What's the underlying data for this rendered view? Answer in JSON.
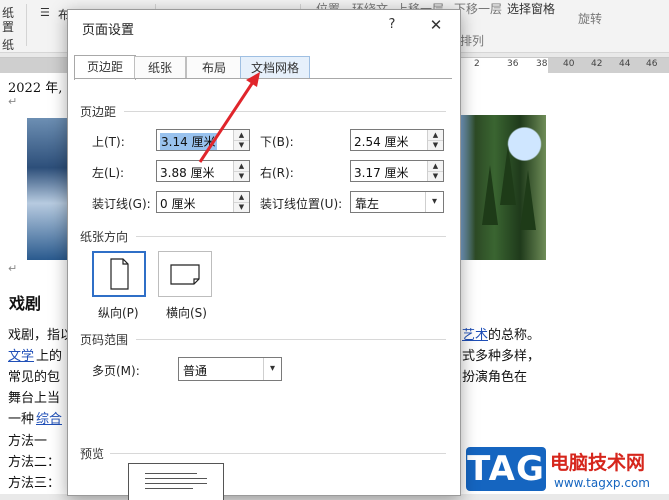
{
  "ribbon": {
    "items": [
      "纸",
      "置",
      "位置",
      "环绕文",
      "上移一层",
      "下移一层",
      "选择窗格",
      "旋转",
      "纸",
      "排列"
    ],
    "indent_icon": "indent-icon"
  },
  "ruler": {
    "numbers": [
      "2",
      "36",
      "38",
      "40",
      "42",
      "44",
      "46"
    ]
  },
  "document": {
    "line_date": "2022 年,",
    "heading": "戏剧",
    "para": [
      "戏剧，指以",
      "艺术",
      "的总称。",
      "文学",
      "上的",
      "式多种多样，",
      "常见的包",
      "扮演角色在",
      "舞台上当",
      "一种",
      "综合"
    ],
    "methods": [
      "方法一",
      "方法二：",
      "方法三：",
      "戏剧"
    ],
    "para_mark": "↵"
  },
  "dialog": {
    "title": "页面设置",
    "help": "?",
    "close": "✕",
    "tabs": [
      "页边距",
      "纸张",
      "布局",
      "文档网格"
    ],
    "margins_section": "页边距",
    "fields": {
      "top_label": "上(T):",
      "top_value": "3.14 厘米",
      "bottom_label": "下(B):",
      "bottom_value": "2.54 厘米",
      "left_label": "左(L):",
      "left_value": "3.88 厘米",
      "right_label": "右(R):",
      "right_value": "3.17 厘米",
      "gutter_label": "装订线(G):",
      "gutter_value": "0 厘米",
      "gutter_pos_label": "装订线位置(U):",
      "gutter_pos_value": "靠左"
    },
    "orientation_section": "纸张方向",
    "portrait": "纵向(P)",
    "landscape": "横向(S)",
    "pages_section": "页码范围",
    "multi_pages_label": "多页(M):",
    "multi_pages_value": "普通",
    "preview_section": "预览"
  },
  "watermark": {
    "logo_text": "TAG",
    "cn_text": "电脑技术网",
    "url": "www.tagxp.com"
  },
  "colors": {
    "accent": "#2f6fc7",
    "selection": "#99c2ee",
    "annotation_arrow": "#e0252b",
    "link": "#1f4fb7"
  }
}
